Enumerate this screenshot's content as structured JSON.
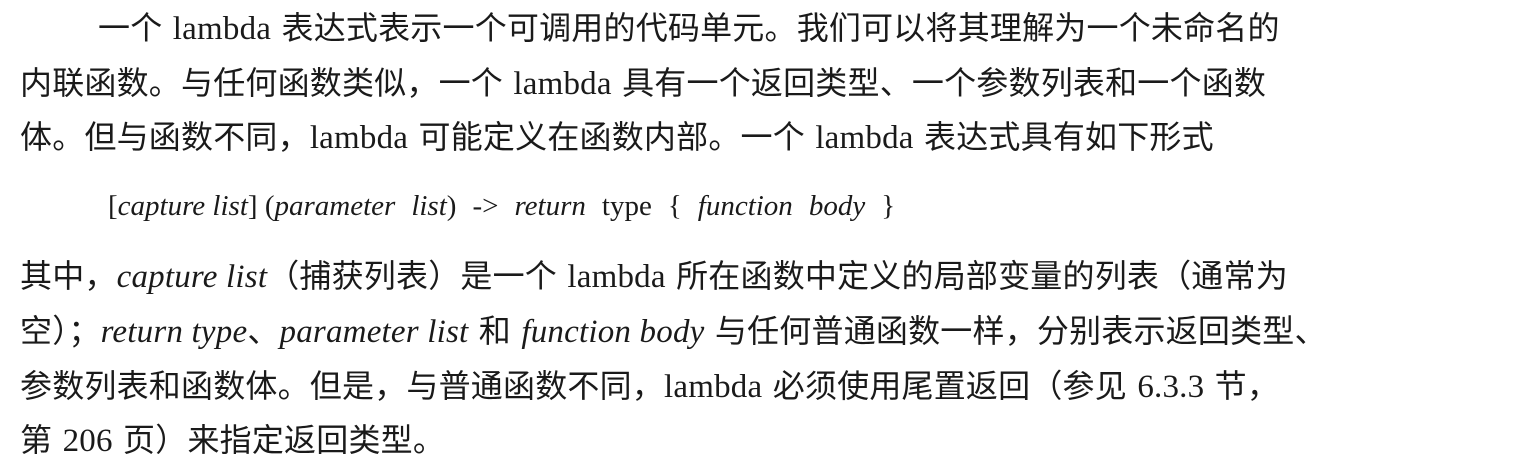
{
  "paragraph1": {
    "line1": {
      "a": "一个 ",
      "b": "lambda",
      "c": " 表达式表示一个可调用的代码单元。我们可以将其理解为一个未命名的"
    },
    "line2": {
      "a": "内联函数。与任何函数类似，一个 ",
      "b": "lambda",
      "c": " 具有一个返回类型、一个参数列表和一个函数"
    },
    "line3": {
      "a": "体。但与函数不同，",
      "b": "lambda",
      "c": " 可能定义在函数内部。一个 ",
      "d": "lambda",
      "e": " 表达式具有如下形式"
    }
  },
  "code": {
    "open_bracket": "[",
    "capture_list": "capture list",
    "close_bracket": "]",
    "open_paren": "(",
    "parameter": "parameter",
    "list": "list",
    "close_paren": ")",
    "arrow": "->",
    "return": "return",
    "type": "type",
    "open_brace": "{",
    "function": "function",
    "body": "body",
    "close_brace": "}"
  },
  "paragraph2": {
    "line1": {
      "a": "其中，",
      "b": "capture list",
      "c": "（捕获列表）是一个 ",
      "d": "lambda",
      "e": " 所在函数中定义的局部变量的列表（通常为"
    },
    "line2": {
      "a": "空）；",
      "b": "return type",
      "c": "、",
      "d": "parameter list",
      "e": " 和 ",
      "f": "function body",
      "g": " 与任何普通函数一样，分别表示返回类型、"
    },
    "line3": {
      "a": "参数列表和函数体。但是，与普通函数不同，",
      "b": "lambda",
      "c": " 必须使用尾置返回（参见 ",
      "d": "6.3.3",
      "e": " 节，"
    },
    "line4": {
      "a": "第 ",
      "b": "206",
      "c": " 页）来指定返回类型。"
    }
  }
}
